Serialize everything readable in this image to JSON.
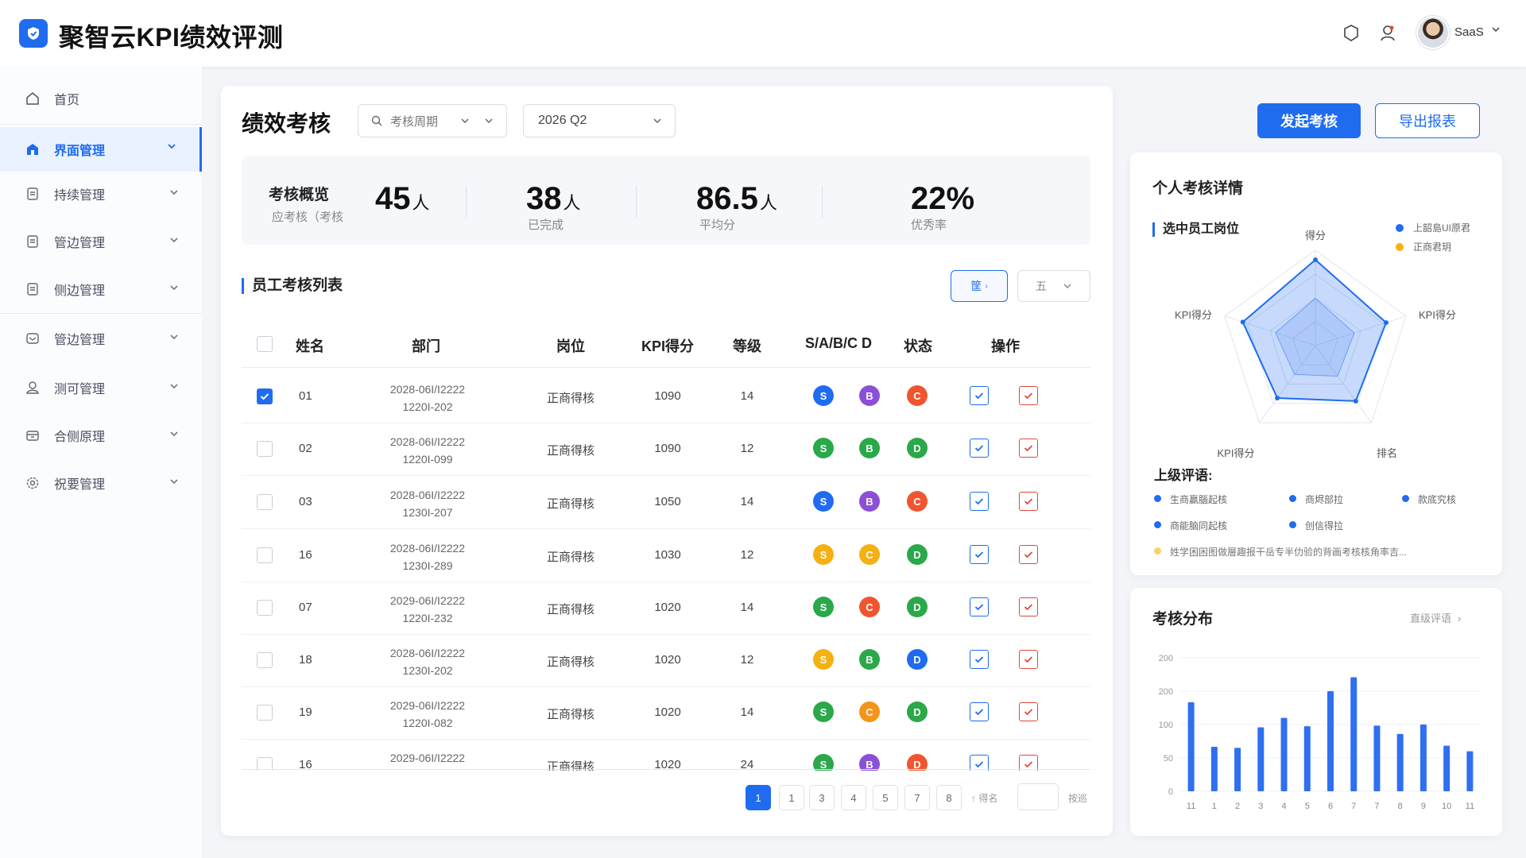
{
  "app": {
    "title": "聚智云KPI绩效评测",
    "user": "SaaS"
  },
  "sidebar": {
    "items": [
      {
        "label": "首页",
        "icon": "home-icon"
      },
      {
        "label": "界面管理",
        "icon": "building-icon",
        "active": true
      },
      {
        "label": "持续管理",
        "icon": "doc-icon"
      },
      {
        "label": "管边管理",
        "icon": "doc-icon"
      },
      {
        "label": "侧边管理",
        "icon": "doc-icon"
      },
      {
        "label": "管边管理",
        "icon": "mail-icon"
      },
      {
        "label": "测可管理",
        "icon": "user-icon"
      },
      {
        "label": "合侧原理",
        "icon": "box-icon"
      },
      {
        "label": "祝要管理",
        "icon": "gear-icon"
      }
    ]
  },
  "header": {
    "title": "绩效考核",
    "period_placeholder": "考核周期",
    "period_value": "2026 Q2",
    "start_btn": "发起考核",
    "export_btn": "导出报表"
  },
  "summary": {
    "title": "考核概览",
    "subtitle": "应考核（考核",
    "stats": [
      {
        "value": "45",
        "unit": "人",
        "label": ""
      },
      {
        "value": "38",
        "unit": "人",
        "label": "已完成"
      },
      {
        "value": "86.5",
        "unit": "人",
        "label": "平均分"
      },
      {
        "value": "22%",
        "unit": "",
        "label": "优秀率"
      }
    ]
  },
  "list": {
    "title": "员工考核列表",
    "filter_btn": "筐",
    "filter_select": "五",
    "columns": [
      "姓名",
      "部门",
      "岗位",
      "KPI得分",
      "等级",
      "S/A/B/C D",
      "状态",
      "操作"
    ],
    "rows": [
      {
        "name": "01",
        "dept1": "2028-06I/I2222",
        "dept2": "1220I-202",
        "pos": "正商得核",
        "kpi": "1090",
        "level": "14",
        "g": [
          "S",
          "B",
          "C"
        ],
        "gc": [
          "#1f6cf0",
          "#8b4fd8",
          "#f0552f"
        ],
        "checked": true
      },
      {
        "name": "02",
        "dept1": "2028-06I/I2222",
        "dept2": "1220I-099",
        "pos": "正商得核",
        "kpi": "1090",
        "level": "12",
        "g": [
          "S",
          "B",
          "D"
        ],
        "gc": [
          "#2aa84a",
          "#2aa84a",
          "#2aa84a"
        ],
        "checked": false
      },
      {
        "name": "03",
        "dept1": "2028-06I/I2222",
        "dept2": "1230I-207",
        "pos": "正商得核",
        "kpi": "1050",
        "level": "14",
        "g": [
          "S",
          "B",
          "C"
        ],
        "gc": [
          "#1f6cf0",
          "#8b4fd8",
          "#f0552f"
        ],
        "checked": false
      },
      {
        "name": "16",
        "dept1": "2028-06I/I2222",
        "dept2": "1230I-289",
        "pos": "正商得核",
        "kpi": "1030",
        "level": "12",
        "g": [
          "S",
          "C",
          "D"
        ],
        "gc": [
          "#f5b014",
          "#f5b014",
          "#2aa84a"
        ],
        "checked": false
      },
      {
        "name": "07",
        "dept1": "2029-06I/I2222",
        "dept2": "1220I-232",
        "pos": "正商得核",
        "kpi": "1020",
        "level": "14",
        "g": [
          "S",
          "C",
          "D"
        ],
        "gc": [
          "#2aa84a",
          "#f0552f",
          "#2aa84a"
        ],
        "checked": false
      },
      {
        "name": "18",
        "dept1": "2028-06I/I2222",
        "dept2": "1230I-202",
        "pos": "正商得核",
        "kpi": "1020",
        "level": "12",
        "g": [
          "S",
          "B",
          "D"
        ],
        "gc": [
          "#f5b014",
          "#2aa84a",
          "#1f6cf0"
        ],
        "checked": false
      },
      {
        "name": "19",
        "dept1": "2029-06I/I2222",
        "dept2": "1220I-082",
        "pos": "正商得核",
        "kpi": "1020",
        "level": "14",
        "g": [
          "S",
          "C",
          "D"
        ],
        "gc": [
          "#2aa84a",
          "#f5931a",
          "#2aa84a"
        ],
        "checked": false
      },
      {
        "name": "16",
        "dept1": "2029-06I/I2222",
        "dept2": "",
        "pos": "正商得核",
        "kpi": "1020",
        "level": "24",
        "g": [
          "S",
          "B",
          "D"
        ],
        "gc": [
          "#2aa84a",
          "#8b4fd8",
          "#f0552f"
        ],
        "checked": false
      }
    ]
  },
  "pagination": {
    "pages": [
      "1",
      "1",
      "3",
      "4",
      "5",
      "7",
      "8"
    ],
    "goto_label": "↑ 得名",
    "jump_label": "按巡"
  },
  "detail": {
    "title": "个人考核详情",
    "subtitle": "选中员工岗位",
    "legend": [
      {
        "label": "上韶島UI原君",
        "color": "#1f6cf0"
      },
      {
        "label": "正商君玥",
        "color": "#f5b014"
      }
    ],
    "radar_labels": [
      "得分",
      "KPI得分",
      "KPI得分",
      "KPI得分",
      "排名"
    ],
    "radar_values": [
      0.9,
      0.78,
      0.72,
      0.68,
      0.8
    ],
    "review_title": "上级评语:",
    "reviews": [
      {
        "text": "生商贏腦起核",
        "color": "#1f6cf0"
      },
      {
        "text": "商烬部拉",
        "color": "#1f6cf0"
      },
      {
        "text": "款底究核",
        "color": "#1f6cf0"
      },
      {
        "text": "商能脑同起核",
        "color": "#1f6cf0"
      },
      {
        "text": "创信得拉",
        "color": "#1f6cf0"
      }
    ],
    "review_note": "姓学困困图做層趣报干岳专半仂验的背画考核核角率吉...",
    "review_note_color": "#f5d36b"
  },
  "distribution": {
    "title": "考核分布",
    "link": "直级评语",
    "chart_data": {
      "type": "bar",
      "categories": [
        "11",
        "1",
        "2",
        "3",
        "4",
        "5",
        "6",
        "7",
        "7",
        "8",
        "9",
        "10",
        "11"
      ],
      "values": [
        160,
        80,
        78,
        115,
        132,
        117,
        180,
        205,
        118,
        103,
        120,
        82,
        72
      ],
      "ylim": [
        0,
        240
      ],
      "ytick_labels": [
        "0",
        "50",
        "100",
        "200",
        "200"
      ],
      "grid": true
    }
  }
}
